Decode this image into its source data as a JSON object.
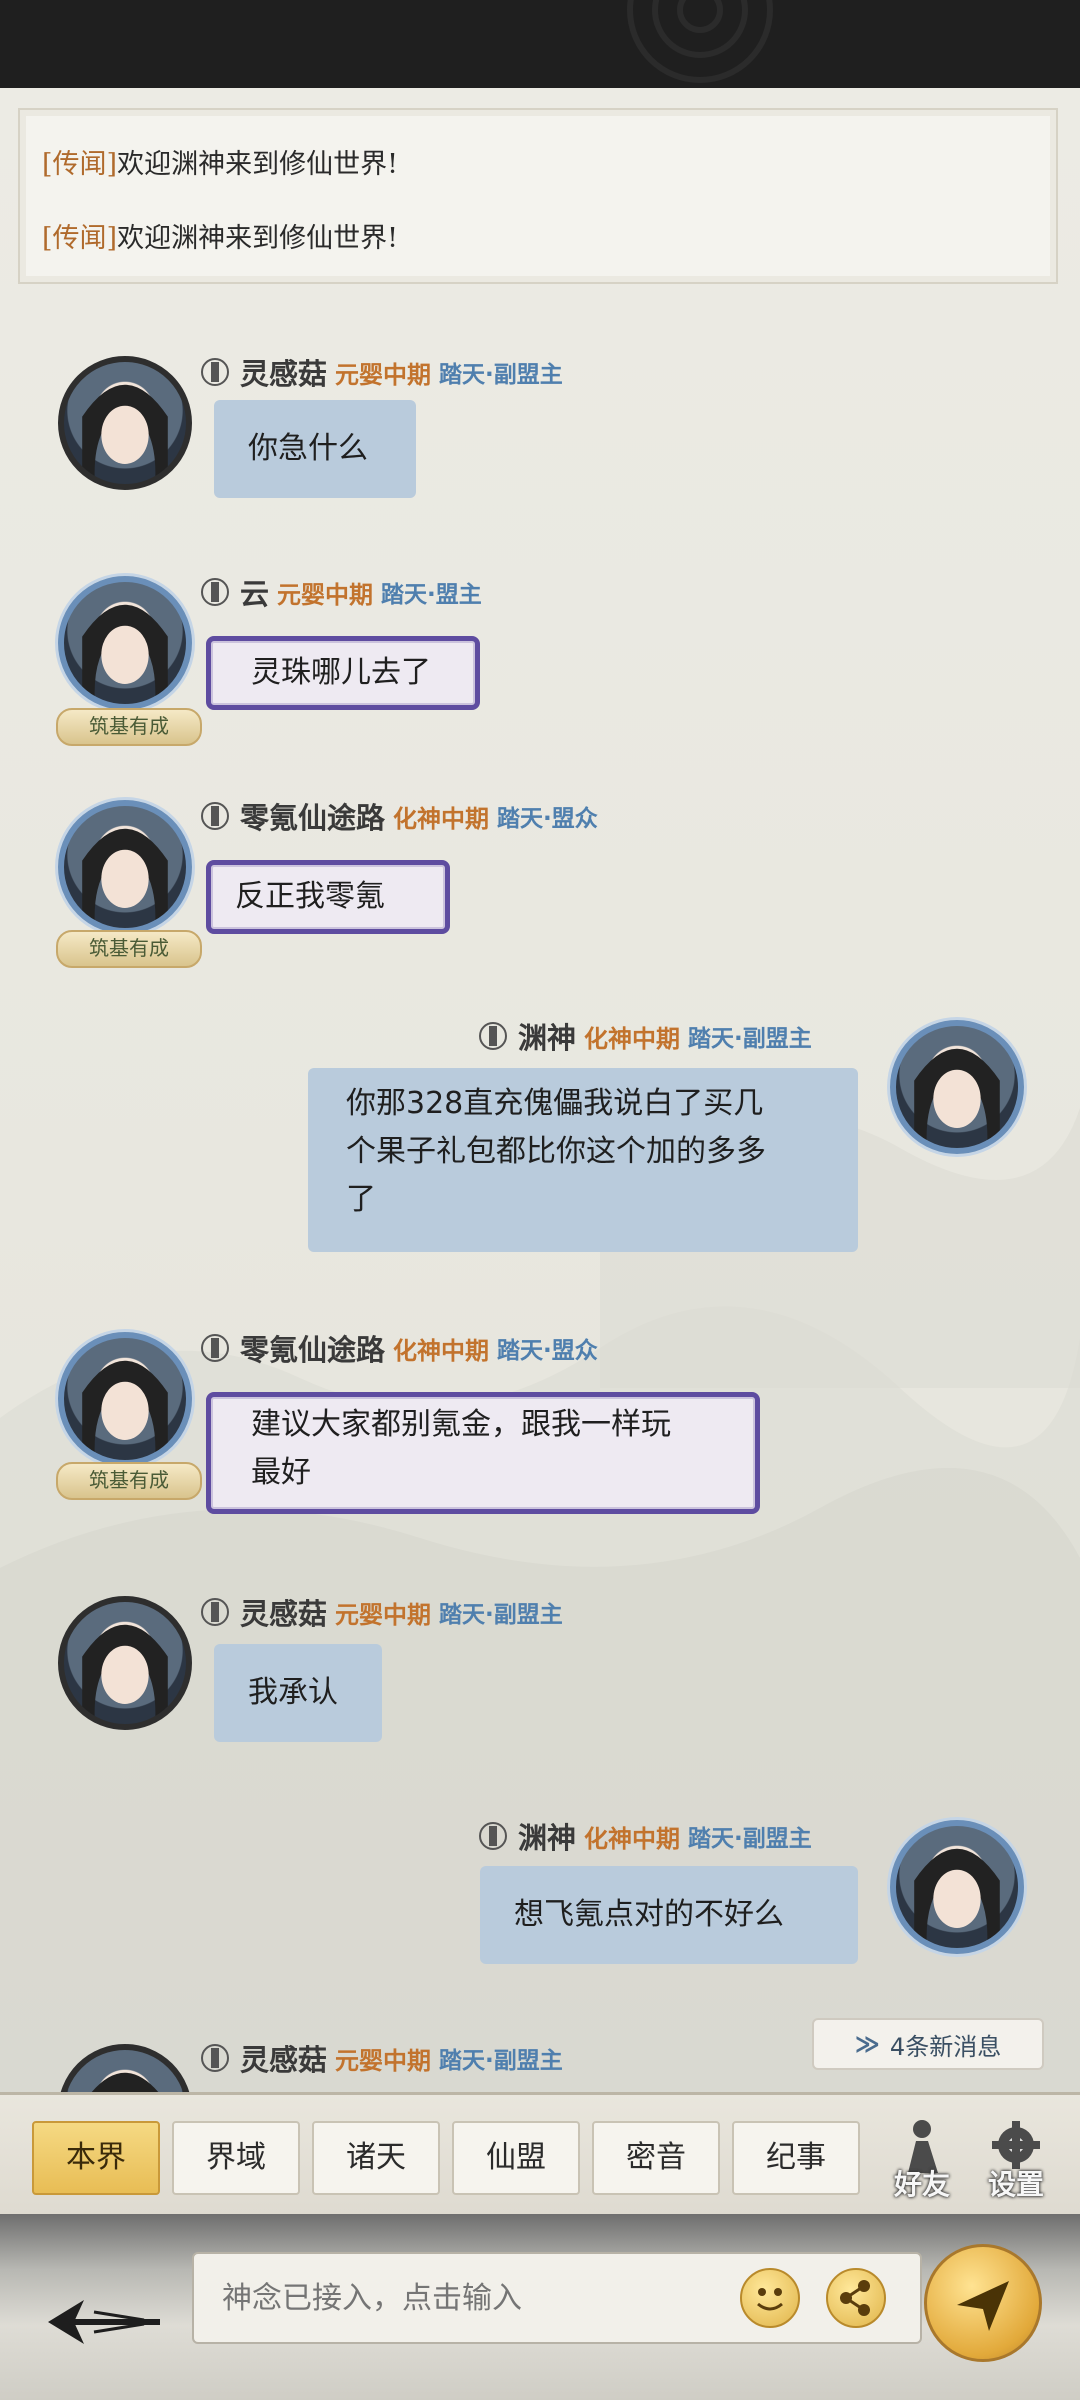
{
  "rumors": [
    {
      "tag": "[传闻]",
      "text": "欢迎渊神来到修仙世界!"
    },
    {
      "tag": "[传闻]",
      "text": "欢迎渊神来到修仙世界!"
    }
  ],
  "messages": [
    {
      "name": "灵感菇",
      "realm": "元婴中期",
      "guild": "踏天·副盟主",
      "text": "你急什么"
    },
    {
      "name": "云",
      "realm": "元婴中期",
      "guild": "踏天·盟主",
      "text": "灵珠哪儿去了",
      "badge": "筑基有成"
    },
    {
      "name": "零氪仙途路",
      "realm": "化神中期",
      "guild": "踏天·盟众",
      "text": "反正我零氪",
      "badge": "筑基有成"
    },
    {
      "name": "渊神",
      "realm": "化神中期",
      "guild": "踏天·副盟主",
      "text_lines": [
        "你那328直充傀儡我说白了买几",
        "个果子礼包都比你这个加的多多",
        "了"
      ]
    },
    {
      "name": "零氪仙途路",
      "realm": "化神中期",
      "guild": "踏天·盟众",
      "text_lines": [
        "建议大家都别氪金，跟我一样玩",
        "最好"
      ],
      "badge": "筑基有成"
    },
    {
      "name": "灵感菇",
      "realm": "元婴中期",
      "guild": "踏天·副盟主",
      "text": "我承认"
    },
    {
      "name": "渊神",
      "realm": "化神中期",
      "guild": "踏天·副盟主",
      "text": "想飞氪点对的不好么"
    },
    {
      "name": "灵感菇",
      "realm": "元婴中期",
      "guild": "踏天·副盟主"
    }
  ],
  "new_messages": "4条新消息",
  "tabs": [
    "本界",
    "界域",
    "诸天",
    "仙盟",
    "密音",
    "纪事"
  ],
  "active_tab": "本界",
  "side_buttons": {
    "friends": "好友",
    "settings": "设置"
  },
  "input": {
    "placeholder": "神念已接入，点击输入"
  },
  "icons": {
    "back": "back-arrow-icon",
    "emoji": "emoji-icon",
    "share": "share-icon",
    "send": "send-icon",
    "rank": "rank-icon",
    "chevron": "double-chevron-down-icon"
  },
  "colors": {
    "realm": "#c2732d",
    "guild": "#4f7fae",
    "rumor_tag": "#b06a2c",
    "active_tab": "#efcb6b"
  }
}
